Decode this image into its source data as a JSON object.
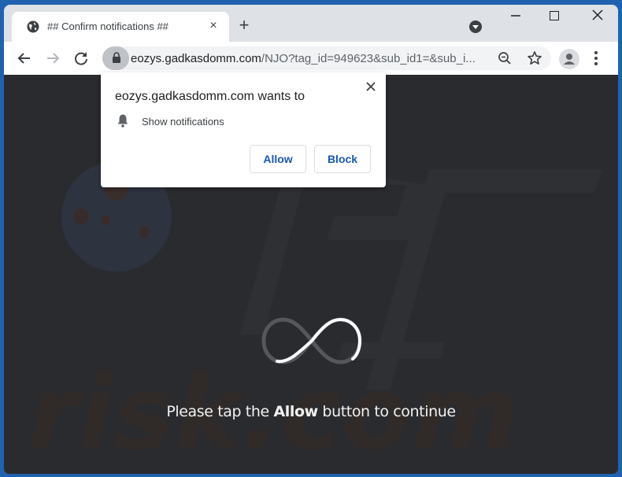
{
  "browser": {
    "tab": {
      "title": "## Confirm notifications ##",
      "icon": "globe-icon",
      "close_label": "×"
    },
    "new_tab_label": "+",
    "address_bar": {
      "host": "eozys.gadkasdomm.com",
      "path": "/NJO?tag_id=949623&sub_id1=&sub_i...",
      "secure_icon": "lock-icon"
    },
    "toolbar_icons": [
      "back-arrow-icon",
      "forward-arrow-icon",
      "reload-icon",
      "zoom-out-icon",
      "star-icon",
      "profile-icon",
      "kebab-menu-icon"
    ]
  },
  "notification_prompt": {
    "title": "eozys.gadkasdomm.com wants to",
    "permission": "Show notifications",
    "allow_label": "Allow",
    "block_label": "Block"
  },
  "page": {
    "message_before": "Please tap the ",
    "message_bold": "Allow",
    "message_after": " button to continue",
    "watermark_text": "risk.com"
  },
  "colors": {
    "frame": "#2062b0",
    "page_background": "#2a2b2f",
    "button_text": "#1a56b8"
  }
}
